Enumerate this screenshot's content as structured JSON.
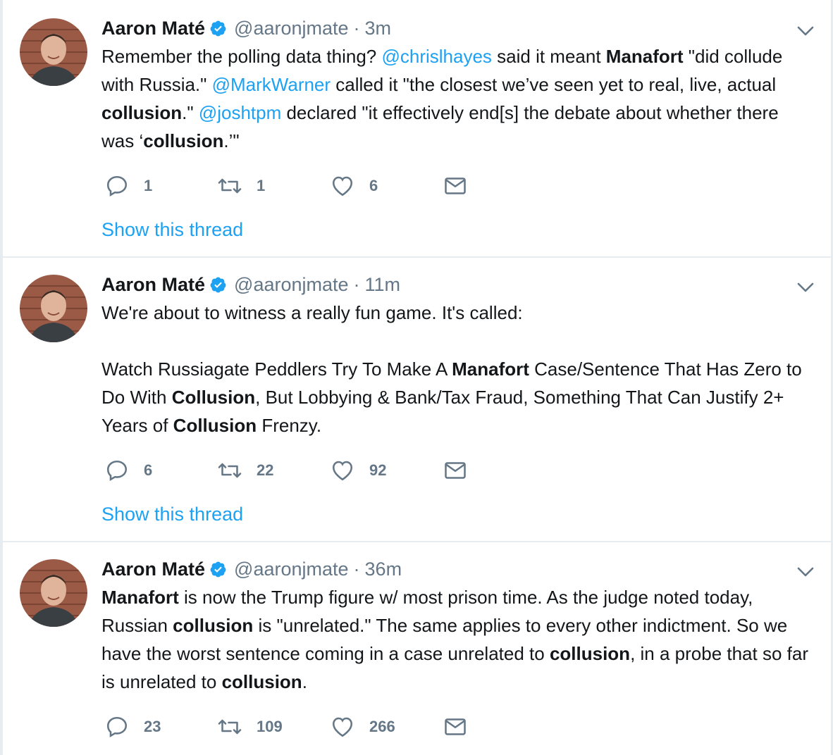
{
  "tweets": [
    {
      "name": "Aaron Maté",
      "handle": "@aaronjmate",
      "separator": "·",
      "time": "3m",
      "body": [
        {
          "t": "Remember the polling data thing? "
        },
        {
          "t": "@chrislhayes",
          "s": "m"
        },
        {
          "t": " said it meant "
        },
        {
          "t": "Manafort",
          "s": "b"
        },
        {
          "t": " \"did collude with Russia.\" "
        },
        {
          "t": "@MarkWarner",
          "s": "m"
        },
        {
          "t": " called it \"the closest we’ve seen yet to real, live, actual "
        },
        {
          "t": "collusion",
          "s": "b"
        },
        {
          "t": ".\" "
        },
        {
          "t": "@joshtpm",
          "s": "m"
        },
        {
          "t": " declared \"it effectively end[s] the debate about whether there was ‘"
        },
        {
          "t": "collusion",
          "s": "b"
        },
        {
          "t": ".’\""
        }
      ],
      "replies": "1",
      "retweets": "1",
      "likes": "6",
      "show_thread": "Show this thread"
    },
    {
      "name": "Aaron Maté",
      "handle": "@aaronjmate",
      "separator": "·",
      "time": "11m",
      "body": [
        {
          "t": "We're about to witness a really fun game. It's called:"
        },
        {
          "t": "\n\n"
        },
        {
          "t": "Watch Russiagate Peddlers Try To Make A "
        },
        {
          "t": "Manafort",
          "s": "b"
        },
        {
          "t": " Case/Sentence That Has Zero to Do With "
        },
        {
          "t": "Collusion",
          "s": "b"
        },
        {
          "t": ", But Lobbying & Bank/Tax Fraud, Something That Can Justify 2+ Years of "
        },
        {
          "t": "Collusion",
          "s": "b"
        },
        {
          "t": " Frenzy."
        }
      ],
      "replies": "6",
      "retweets": "22",
      "likes": "92",
      "show_thread": "Show this thread"
    },
    {
      "name": "Aaron Maté",
      "handle": "@aaronjmate",
      "separator": "·",
      "time": "36m",
      "body": [
        {
          "t": "Manafort",
          "s": "b"
        },
        {
          "t": " is now the Trump figure w/ most prison time. As the judge noted today, Russian "
        },
        {
          "t": "collusion",
          "s": "b"
        },
        {
          "t": " is \"unrelated.\" The same applies to every other indictment. So we have the worst sentence coming in a case unrelated to "
        },
        {
          "t": "collusion",
          "s": "b"
        },
        {
          "t": ", in a probe that so far is unrelated to "
        },
        {
          "t": "collusion",
          "s": "b"
        },
        {
          "t": "."
        }
      ],
      "replies": "23",
      "retweets": "109",
      "likes": "266",
      "show_thread": ""
    }
  ],
  "icons": {
    "verified": "verified-badge-icon",
    "caret": "chevron-down-icon",
    "reply": "reply-icon",
    "retweet": "retweet-icon",
    "like": "heart-icon",
    "dm": "envelope-icon"
  },
  "colors": {
    "link": "#1da1f2",
    "muted": "#657786",
    "text": "#14171a",
    "divider": "#e6ecf0"
  }
}
